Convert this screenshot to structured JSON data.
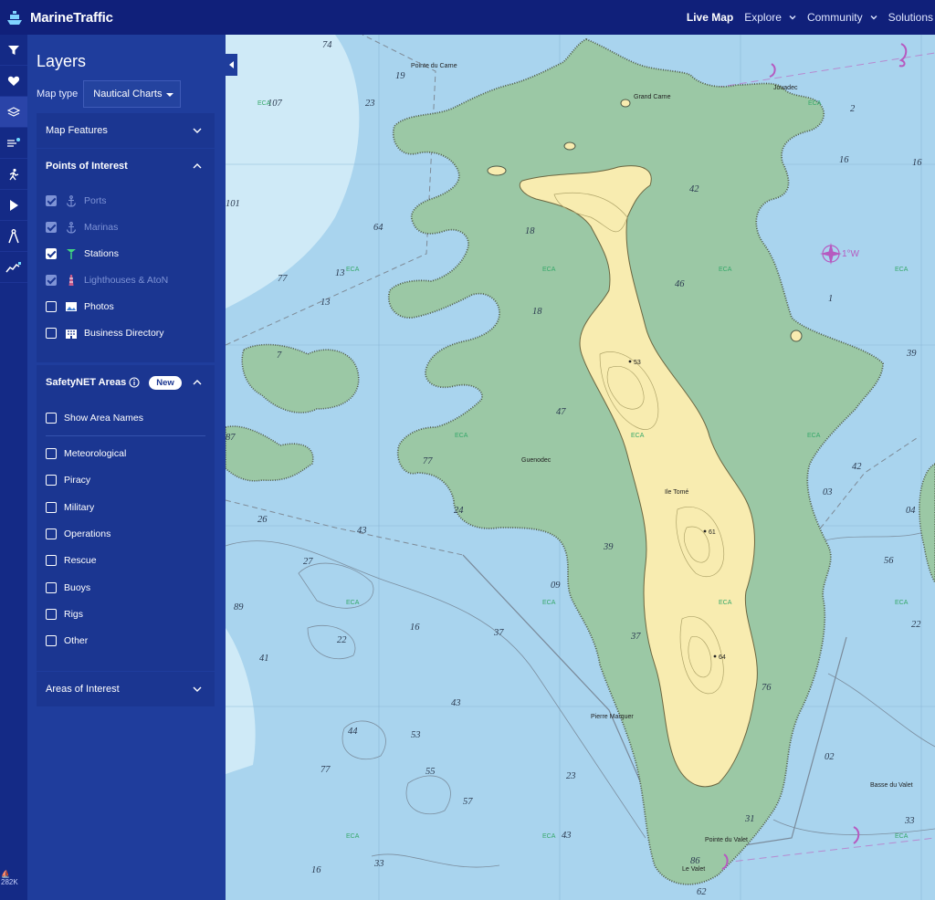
{
  "app": {
    "brand": "MarineTraffic",
    "nav": [
      {
        "label": "Live Map",
        "active": true,
        "has_menu": false
      },
      {
        "label": "Explore",
        "active": false,
        "has_menu": true
      },
      {
        "label": "Community",
        "active": false,
        "has_menu": true
      },
      {
        "label": "Solutions",
        "active": false,
        "has_menu": false
      }
    ]
  },
  "icon_strip": {
    "items": [
      "filter-icon",
      "heart-icon",
      "layers-icon",
      "weather-icon",
      "route-icon",
      "play-icon",
      "measure-icon",
      "trend-icon"
    ],
    "footer_count": "282K"
  },
  "panel": {
    "title": "Layers",
    "map_type_label": "Map type",
    "map_type_value": "Nautical Charts",
    "map_features": "Map Features",
    "points_of_interest": {
      "title": "Points of Interest",
      "items": [
        {
          "label": "Ports",
          "checked": true,
          "dim": true,
          "icon": "anchor-icon"
        },
        {
          "label": "Marinas",
          "checked": true,
          "dim": true,
          "icon": "anchor-icon"
        },
        {
          "label": "Stations",
          "checked": true,
          "dim": false,
          "icon": "station-icon"
        },
        {
          "label": "Lighthouses & AtoN",
          "checked": true,
          "dim": true,
          "icon": "lighthouse-icon"
        },
        {
          "label": "Photos",
          "checked": false,
          "dim": false,
          "icon": "photo-icon"
        },
        {
          "label": "Business Directory",
          "checked": false,
          "dim": false,
          "icon": "building-icon"
        }
      ]
    },
    "safetynet": {
      "title": "SafetyNET Areas",
      "badge": "New",
      "show_area_names": "Show Area Names",
      "items": [
        "Meteorological",
        "Piracy",
        "Military",
        "Operations",
        "Rescue",
        "Buoys",
        "Rigs",
        "Other"
      ]
    },
    "areas_of_interest": "Areas of Interest"
  },
  "map": {
    "colors": {
      "water": "#a9d4ee",
      "shallow": "#cfeaf7",
      "land": "#9bc8a5",
      "high": "#f8ecb0"
    },
    "depths": [
      "74",
      "19",
      "23",
      "107",
      "101",
      "64",
      "77",
      "13",
      "13",
      "7",
      "87",
      "26",
      "43",
      "27",
      "89",
      "22",
      "41",
      "16",
      "37",
      "43",
      "44",
      "53",
      "55",
      "77",
      "57",
      "23",
      "33",
      "16",
      "18",
      "18",
      "42",
      "46",
      "47",
      "77",
      "24",
      "39",
      "09",
      "37",
      "76",
      "2",
      "16",
      "16",
      "1",
      "39",
      "42",
      "03",
      "04",
      "56",
      "22",
      "02",
      "33",
      "31",
      "43",
      "86",
      "62"
    ],
    "places": [
      "Pointe du Carne",
      "Grand Carne",
      "Jouadec",
      "Guenodec",
      "Ile Tomé",
      "Pierre Marquer",
      "Pointe du Valet",
      "Le Valet",
      "Basse du Valet"
    ],
    "heights": [
      "53",
      "61",
      "64"
    ],
    "eca_label": "ECA",
    "compass_label": "1°W"
  }
}
